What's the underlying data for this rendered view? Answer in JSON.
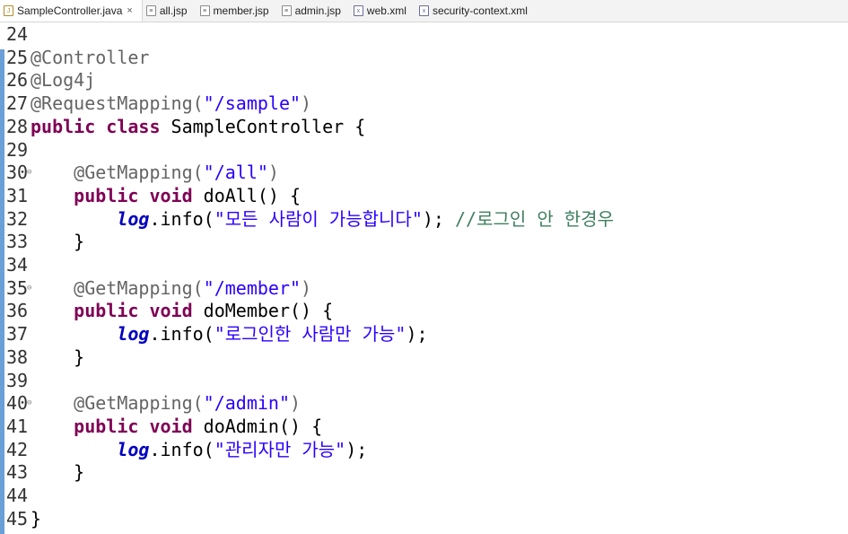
{
  "tabs": [
    {
      "label": "SampleController.java",
      "icon": "java-file-icon",
      "active": true,
      "closable": true
    },
    {
      "label": "all.jsp",
      "icon": "jsp-file-icon"
    },
    {
      "label": "member.jsp",
      "icon": "jsp-file-icon"
    },
    {
      "label": "admin.jsp",
      "icon": "jsp-file-icon"
    },
    {
      "label": "web.xml",
      "icon": "xml-file-icon"
    },
    {
      "label": "security-context.xml",
      "icon": "xml-file-icon"
    }
  ],
  "close_glyph": "×",
  "code": [
    {
      "n": "24",
      "t": []
    },
    {
      "n": "25",
      "t": [
        [
          "ann",
          "@Controller"
        ]
      ]
    },
    {
      "n": "26",
      "t": [
        [
          "ann",
          "@Log4j"
        ]
      ]
    },
    {
      "n": "27",
      "t": [
        [
          "ann",
          "@RequestMapping("
        ],
        [
          "str",
          "\"/sample\""
        ],
        [
          "ann",
          ")"
        ]
      ]
    },
    {
      "n": "28",
      "t": [
        [
          "kw",
          "public"
        ],
        [
          "",
          " "
        ],
        [
          "kw",
          "class"
        ],
        [
          "",
          " SampleController {"
        ]
      ]
    },
    {
      "n": "29",
      "t": []
    },
    {
      "n": "30",
      "fold": true,
      "t": [
        [
          "",
          "    "
        ],
        [
          "ann",
          "@GetMapping("
        ],
        [
          "str",
          "\"/all\""
        ],
        [
          "ann",
          ")"
        ]
      ]
    },
    {
      "n": "31",
      "t": [
        [
          "",
          "    "
        ],
        [
          "kw",
          "public"
        ],
        [
          "",
          " "
        ],
        [
          "kw",
          "void"
        ],
        [
          "",
          " doAll() {"
        ]
      ]
    },
    {
      "n": "32",
      "t": [
        [
          "",
          "        "
        ],
        [
          "fld",
          "log"
        ],
        [
          "",
          ".info("
        ],
        [
          "str",
          "\"모든 사람이 가능합니다\""
        ],
        [
          "",
          "); "
        ],
        [
          "cm",
          "//로그인 안 한경우"
        ]
      ]
    },
    {
      "n": "33",
      "t": [
        [
          "",
          "    }"
        ]
      ]
    },
    {
      "n": "34",
      "t": []
    },
    {
      "n": "35",
      "fold": true,
      "t": [
        [
          "",
          "    "
        ],
        [
          "ann",
          "@GetMapping("
        ],
        [
          "str",
          "\"/member\""
        ],
        [
          "ann",
          ")"
        ]
      ]
    },
    {
      "n": "36",
      "t": [
        [
          "",
          "    "
        ],
        [
          "kw",
          "public"
        ],
        [
          "",
          " "
        ],
        [
          "kw",
          "void"
        ],
        [
          "",
          " doMember() {"
        ]
      ]
    },
    {
      "n": "37",
      "t": [
        [
          "",
          "        "
        ],
        [
          "fld",
          "log"
        ],
        [
          "",
          ".info("
        ],
        [
          "str",
          "\"로그인한 사람만 가능\""
        ],
        [
          "",
          ");"
        ]
      ]
    },
    {
      "n": "38",
      "t": [
        [
          "",
          "    }"
        ]
      ]
    },
    {
      "n": "39",
      "t": []
    },
    {
      "n": "40",
      "fold": true,
      "t": [
        [
          "",
          "    "
        ],
        [
          "ann",
          "@GetMapping("
        ],
        [
          "str",
          "\"/admin\""
        ],
        [
          "ann",
          ")"
        ]
      ]
    },
    {
      "n": "41",
      "t": [
        [
          "",
          "    "
        ],
        [
          "kw",
          "public"
        ],
        [
          "",
          " "
        ],
        [
          "kw",
          "void"
        ],
        [
          "",
          " doAdmin() {"
        ]
      ]
    },
    {
      "n": "42",
      "t": [
        [
          "",
          "        "
        ],
        [
          "fld",
          "log"
        ],
        [
          "",
          ".info("
        ],
        [
          "str",
          "\"관리자만 가능\""
        ],
        [
          "",
          ");"
        ]
      ]
    },
    {
      "n": "43",
      "t": [
        [
          "",
          "    }"
        ]
      ]
    },
    {
      "n": "44",
      "t": []
    },
    {
      "n": "45",
      "t": [
        [
          "",
          "}"
        ]
      ]
    }
  ],
  "colors": {
    "keyword": "#7f0055",
    "annotation": "#646464",
    "string": "#2a00ff",
    "comment": "#3f7f5f",
    "field": "#0000c0",
    "change_bar": "#6a9fd8"
  }
}
